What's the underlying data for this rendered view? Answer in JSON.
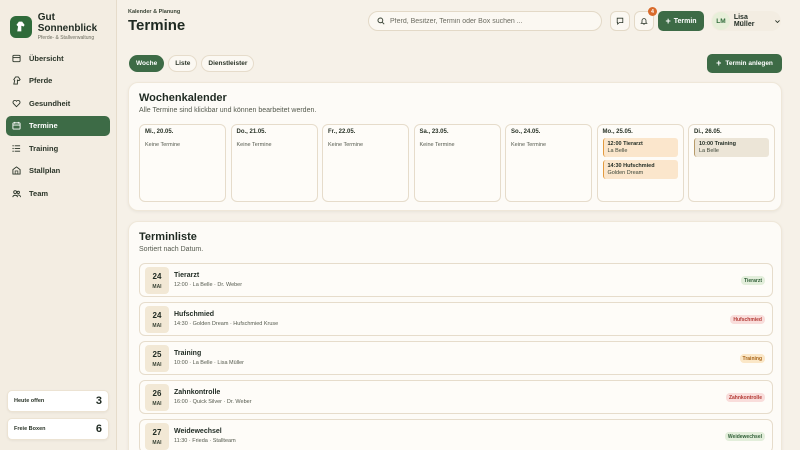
{
  "brand": {
    "name": "Gut Sonnenblick",
    "subtitle": "Pferde- & Stallverwaltung"
  },
  "nav": [
    {
      "label": "Übersicht",
      "icon": "overview-icon"
    },
    {
      "label": "Pferde",
      "icon": "horse-icon"
    },
    {
      "label": "Gesundheit",
      "icon": "heart-icon"
    },
    {
      "label": "Termine",
      "icon": "calendar-icon",
      "active": true
    },
    {
      "label": "Training",
      "icon": "list-icon"
    },
    {
      "label": "Stallplan",
      "icon": "stable-icon"
    },
    {
      "label": "Team",
      "icon": "team-icon"
    }
  ],
  "stats": [
    {
      "label": "Heute offen",
      "value": "3"
    },
    {
      "label": "Freie Boxen",
      "value": "6"
    }
  ],
  "header": {
    "breadcrumb": "Kalender & Planung",
    "title": "Termine",
    "search_placeholder": "Pferd, Besitzer, Termin oder Box suchen ...",
    "notification_count": "4",
    "termin_label": "Termin",
    "user_initials": "LM",
    "user_name": "Lisa Müller"
  },
  "tabs": [
    "Woche",
    "Liste",
    "Dienstleister"
  ],
  "primary_action": "Termin anlegen",
  "week": {
    "title": "Wochenkalender",
    "subtitle": "Alle Termine sind klickbar und können bearbeitet werden.",
    "empty_label": "Keine Termine",
    "days": [
      {
        "label": "Mi., 20.05.",
        "events": []
      },
      {
        "label": "Do., 21.05.",
        "events": []
      },
      {
        "label": "Fr., 22.05.",
        "events": []
      },
      {
        "label": "Sa., 23.05.",
        "events": []
      },
      {
        "label": "So., 24.05.",
        "events": []
      },
      {
        "label": "Mo., 25.05.",
        "events": [
          {
            "title": "12:00 Tierarzt",
            "sub": "La Belle",
            "style": "orange"
          },
          {
            "title": "14:30 Hufschmied",
            "sub": "Golden Dream",
            "style": "orange"
          }
        ]
      },
      {
        "label": "Di., 26.05.",
        "events": [
          {
            "title": "10:00 Training",
            "sub": "La Belle",
            "style": "gray"
          }
        ]
      }
    ]
  },
  "list": {
    "title": "Terminliste",
    "subtitle": "Sortiert nach Datum.",
    "items": [
      {
        "day": "24",
        "month": "MAI",
        "title": "Tierarzt",
        "sub": "12:00 · La Belle · Dr. Weber",
        "tag": "Tierarzt",
        "tag_style": "green"
      },
      {
        "day": "24",
        "month": "MAI",
        "title": "Hufschmied",
        "sub": "14:30 · Golden Dream · Hufschmied Kruse",
        "tag": "Hufschmied",
        "tag_style": "red"
      },
      {
        "day": "25",
        "month": "MAI",
        "title": "Training",
        "sub": "10:00 · La Belle · Lisa Müller",
        "tag": "Training",
        "tag_style": "orange"
      },
      {
        "day": "26",
        "month": "MAI",
        "title": "Zahnkontrolle",
        "sub": "16:00 · Quick Silver · Dr. Weber",
        "tag": "Zahnkontrolle",
        "tag_style": "red"
      },
      {
        "day": "27",
        "month": "MAI",
        "title": "Weidewechsel",
        "sub": "11:30 · Frieda · Stallteam",
        "tag": "Weidewechsel",
        "tag_style": "green"
      }
    ]
  },
  "colors": {
    "primary": "#3d6b46",
    "background": "#f6f1e8",
    "accent": "#d96b2b"
  }
}
